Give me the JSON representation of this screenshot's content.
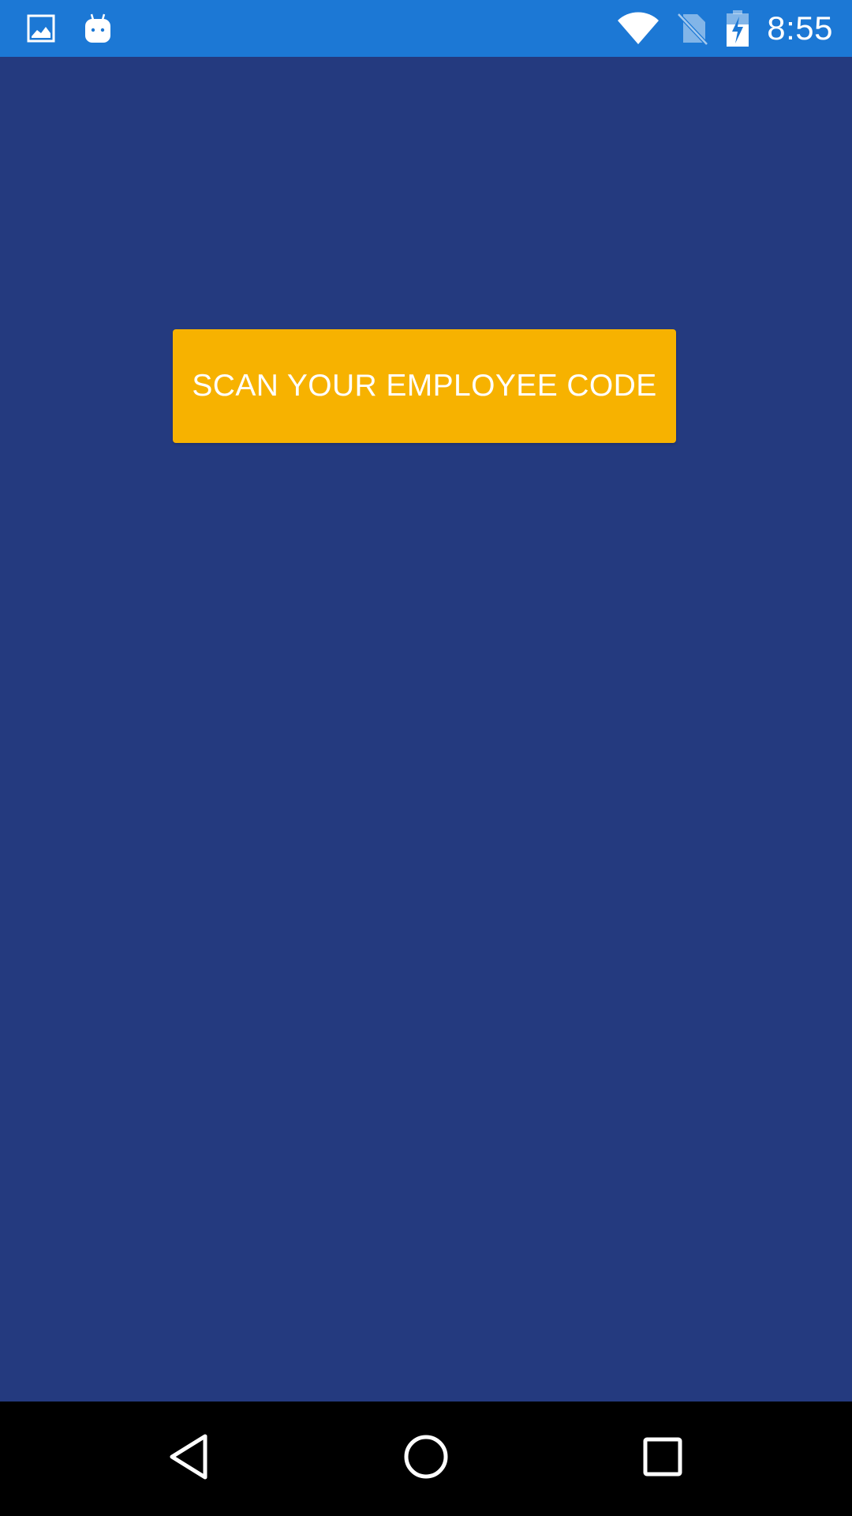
{
  "status_bar": {
    "time": "8:55",
    "background_color": "#1c78d5",
    "icons": [
      "image-notification-icon",
      "android-debug-icon",
      "wifi-icon",
      "no-sim-icon",
      "battery-charging-icon"
    ]
  },
  "main": {
    "background_color": "#243a7f",
    "scan_button_label": "SCAN YOUR EMPLOYEE CODE",
    "scan_button_color": "#f7b200"
  },
  "nav_bar": {
    "background_color": "#000000",
    "icons": [
      "back-icon",
      "home-icon",
      "recents-icon"
    ]
  }
}
